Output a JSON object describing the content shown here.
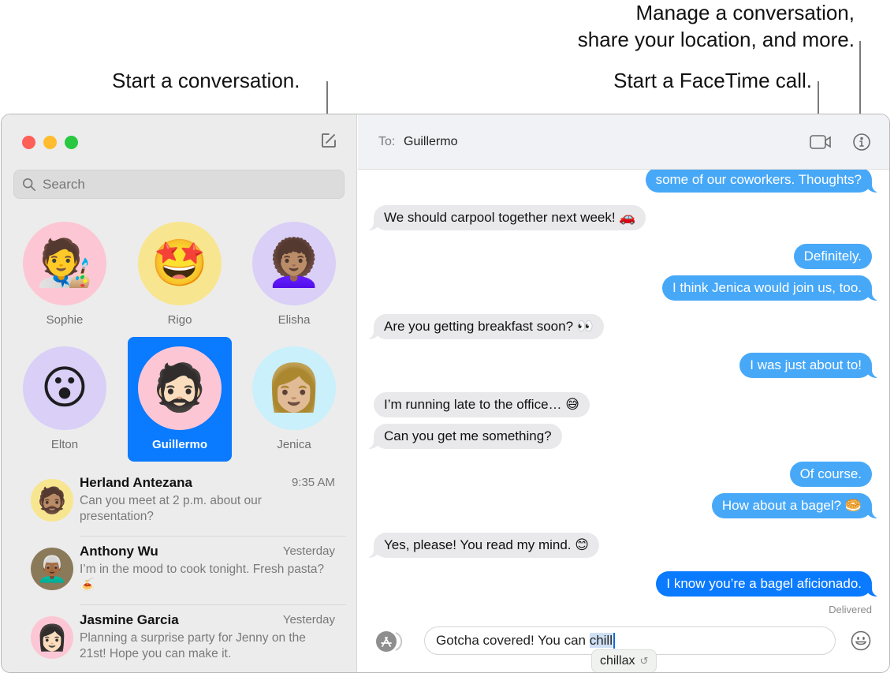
{
  "callouts": {
    "start_conversation": "Start a conversation.",
    "manage_line1": "Manage a conversation,",
    "manage_line2": "share your location, and more.",
    "facetime": "Start a FaceTime call."
  },
  "window": {
    "traffic_colors": {
      "close": "#fe5f57",
      "minimize": "#febc2e",
      "zoom": "#28c840"
    },
    "accent": "#0a7aff"
  },
  "sidebar": {
    "search_placeholder": "Search",
    "pinned": [
      {
        "name": "Sophie",
        "emoji": "🧑‍🎨",
        "bg": "#fcc6d4",
        "selected": false
      },
      {
        "name": "Rigo",
        "emoji": "🤩",
        "bg": "#f8e58f",
        "selected": false
      },
      {
        "name": "Elisha",
        "emoji": "👩🏽‍🦱",
        "bg": "#d9cff7",
        "selected": false
      },
      {
        "name": "Elton",
        "emoji": "😮",
        "bg": "#d9cff7",
        "selected": false
      },
      {
        "name": "Guillermo",
        "emoji": "🧔🏻",
        "bg": "#fcc6d4",
        "selected": true
      },
      {
        "name": "Jenica",
        "emoji": "👩🏼",
        "bg": "#c9f0fb",
        "selected": false
      }
    ],
    "conversations": [
      {
        "name": "Herland Antezana",
        "time": "9:35 AM",
        "preview": "Can you meet at 2 p.m. about our presentation?",
        "emoji": "🧔🏽",
        "bg": "#f8e58f"
      },
      {
        "name": "Anthony Wu",
        "time": "Yesterday",
        "preview": "I’m in the mood to cook tonight. Fresh pasta? 🍝",
        "emoji": "👨🏾‍🦳",
        "bg": "#8a7a5a"
      },
      {
        "name": "Jasmine Garcia",
        "time": "Yesterday",
        "preview": "Planning a surprise party for Jenny on the 21st! Hope you can make it.",
        "emoji": "👩🏻",
        "bg": "#fcc6d4"
      }
    ]
  },
  "chat": {
    "to_label": "To:",
    "recipient": "Guillermo",
    "messages": [
      {
        "dir": "out",
        "text": "some of our coworkers. Thoughts?",
        "tail": true
      },
      {
        "dir": "in",
        "text": "We should carpool together next week! 🚗",
        "tail": true
      },
      {
        "dir": "out",
        "text": "Definitely.",
        "tail": false
      },
      {
        "dir": "out",
        "text": "I think Jenica would join us, too.",
        "tail": true
      },
      {
        "dir": "in",
        "text": "Are you getting breakfast soon? 👀",
        "tail": true
      },
      {
        "dir": "out",
        "text": "I was just about to!",
        "tail": true
      },
      {
        "dir": "in",
        "text": "I’m running late to the office… 😅",
        "tail": false
      },
      {
        "dir": "in",
        "text": "Can you get me something?",
        "tail": true
      },
      {
        "dir": "out",
        "text": "Of course.",
        "tail": false
      },
      {
        "dir": "out",
        "text": "How about a bagel? 🥯",
        "tail": true
      },
      {
        "dir": "in",
        "text": "Yes, please! You read my mind. 😊",
        "tail": true
      },
      {
        "dir": "out",
        "text": "I know you’re a bagel aficionado.",
        "tail": true,
        "last": true
      }
    ],
    "status": "Delivered",
    "compose": {
      "text_before": "Gotcha covered! You can ",
      "text_selected": "chill",
      "suggestion": "chillax",
      "suggestion_undo_icon": "↺"
    },
    "colors": {
      "incoming": "#e9e9eb",
      "outgoing": "#47a8f8",
      "outgoing_latest": "#0a7aff"
    }
  }
}
